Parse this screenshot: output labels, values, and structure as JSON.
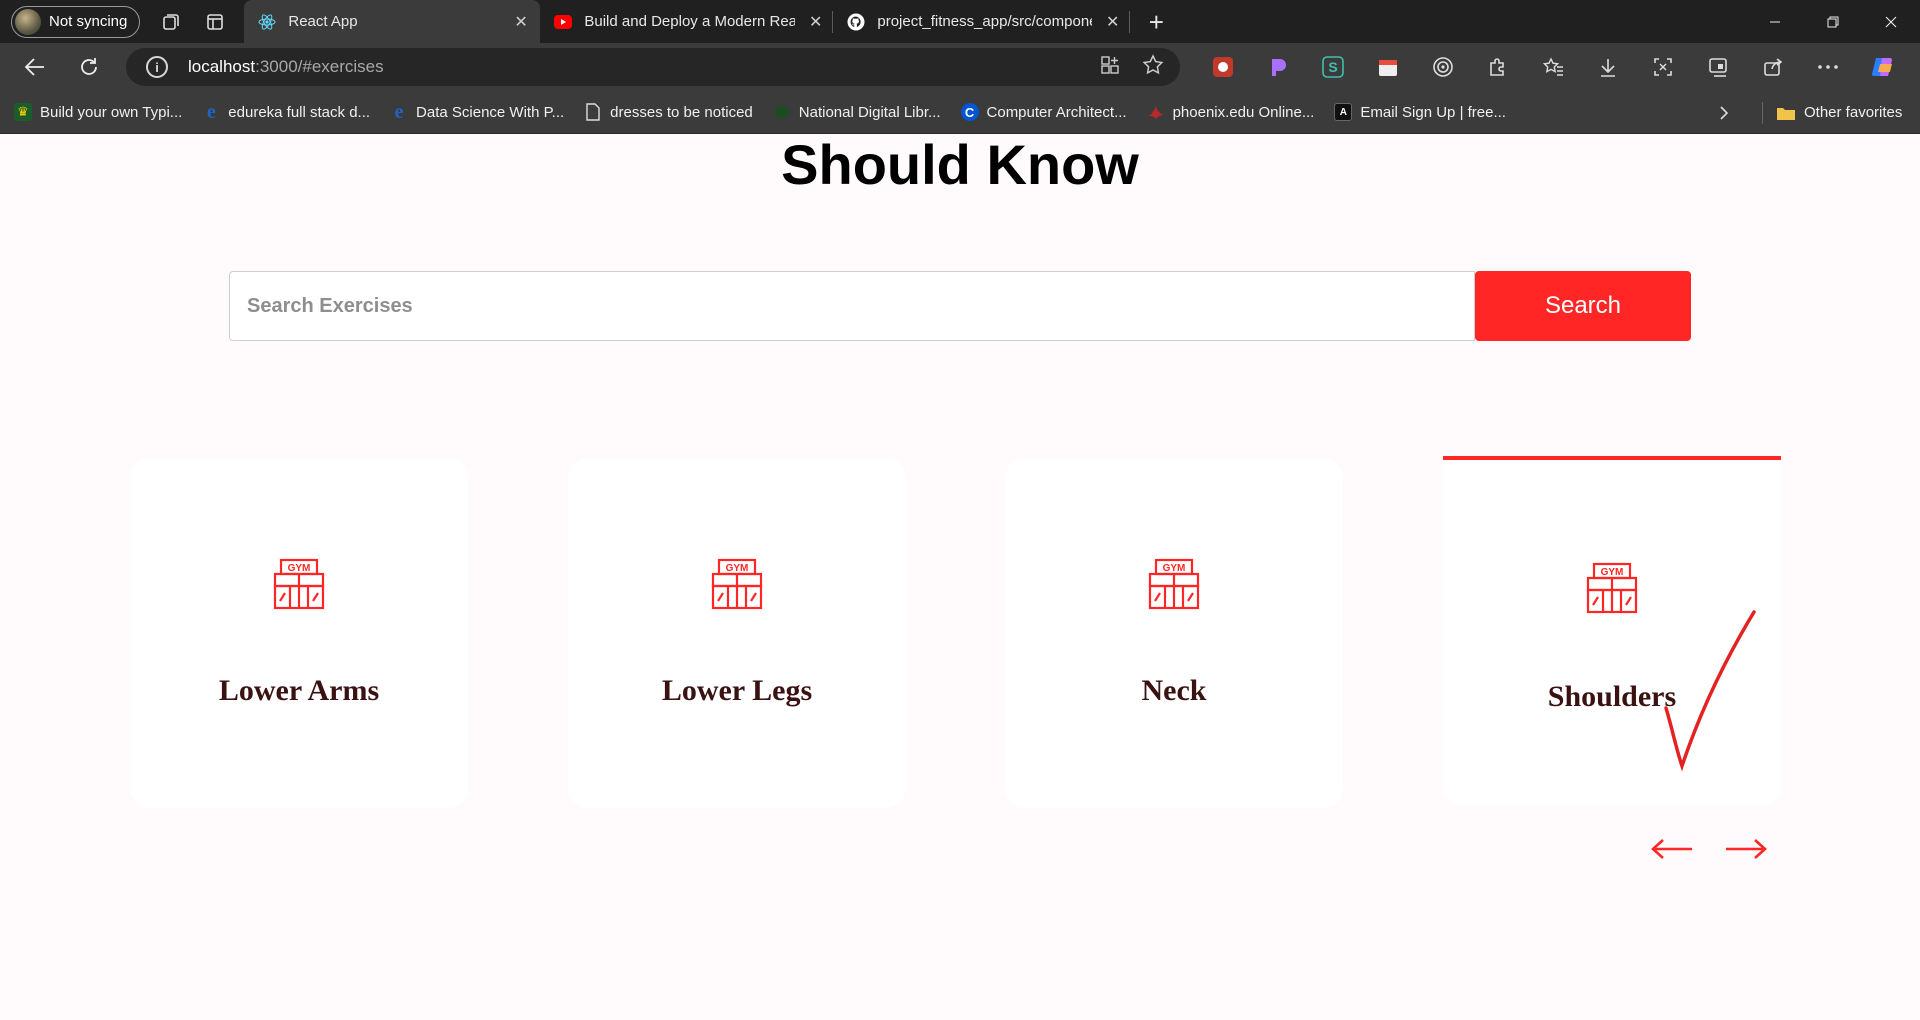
{
  "browser": {
    "profile_label": "Not syncing",
    "tabs": [
      {
        "title": "React App",
        "active": true,
        "favicon": "react-icon"
      },
      {
        "title": "Build and Deploy a Modern React",
        "active": false,
        "favicon": "youtube-icon"
      },
      {
        "title": "project_fitness_app/src/compone",
        "active": false,
        "favicon": "github-icon"
      }
    ],
    "url_host": "localhost",
    "url_rest": ":3000/#exercises",
    "bookmarks": [
      {
        "label": "Build your own Typi...",
        "icon": "bookmark-favicon"
      },
      {
        "label": "edureka full stack d...",
        "icon": "edureka-icon"
      },
      {
        "label": "Data Science With P...",
        "icon": "edureka-icon"
      },
      {
        "label": "dresses to be noticed",
        "icon": "page-icon"
      },
      {
        "label": "National Digital Libr...",
        "icon": "globe-icon"
      },
      {
        "label": "Computer Architect...",
        "icon": "coursera-icon"
      },
      {
        "label": "phoenix.edu Online...",
        "icon": "phoenix-icon"
      },
      {
        "label": "Email Sign Up | free...",
        "icon": "email-icon"
      }
    ],
    "other_favorites": "Other favorites"
  },
  "page": {
    "heading": "Should Know",
    "search": {
      "placeholder": "Search Exercises",
      "value": "",
      "button_label": "Search"
    },
    "body_parts": [
      {
        "label": "Lower Arms",
        "selected": false
      },
      {
        "label": "Lower Legs",
        "selected": false
      },
      {
        "label": "Neck",
        "selected": false
      },
      {
        "label": "Shoulders",
        "selected": true
      }
    ],
    "accent_color": "#ff2625"
  }
}
